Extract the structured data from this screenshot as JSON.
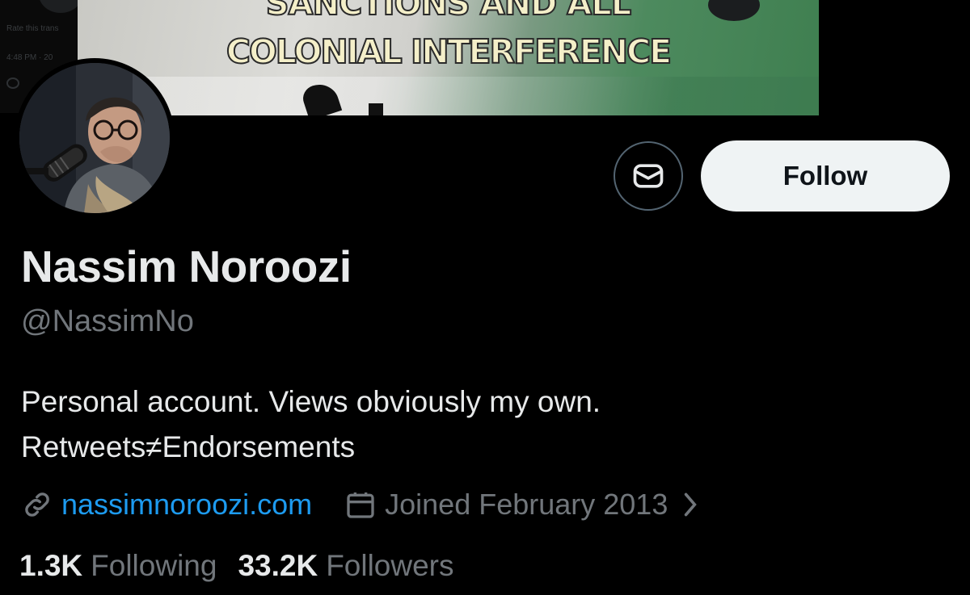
{
  "background_fragment": {
    "rate_text": "Rate this trans",
    "time_text": "4:48 PM · 20"
  },
  "banner": {
    "line1": "SANCTIONS AND ALL",
    "line2": "COLONIAL INTERFERENCE"
  },
  "actions": {
    "message_icon": "envelope-icon",
    "follow_label": "Follow"
  },
  "profile": {
    "name": "Nassim Noroozi",
    "handle": "@NassimNo",
    "bio_line1": "Personal account. Views obviously my own.",
    "bio_line2": "Retweets≠Endorsements",
    "website": "nassimnoroozi.com",
    "joined": "Joined February 2013"
  },
  "stats": {
    "following_count": "1.3K",
    "following_label": "Following",
    "followers_count": "33.2K",
    "followers_label": "Followers"
  },
  "colors": {
    "background": "#000000",
    "primary_text": "#e7e9ea",
    "secondary_text": "#71767b",
    "link": "#1d9bf0",
    "follow_button_bg": "#eff3f4",
    "follow_button_text": "#0f1419",
    "outline": "#536471"
  }
}
